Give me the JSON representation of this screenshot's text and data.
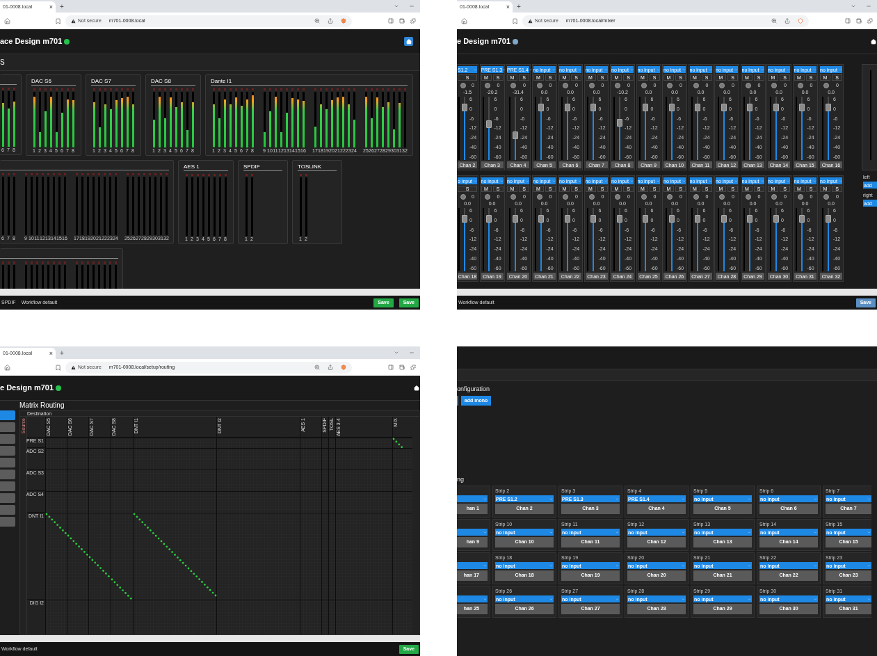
{
  "windows": [
    {
      "kind": "meters",
      "tab": {
        "title": "01-0008.local",
        "close": "×"
      },
      "new_tab": "+",
      "address": {
        "security": "Not secure",
        "url": "m701-0008.local"
      },
      "app_title": "ace Design m701",
      "status": {
        "color": "#27c24c"
      },
      "home": {
        "highlighted": true
      },
      "section": "S",
      "rows": [
        {
          "groups": [
            {
              "banks": [
                {
                  "meters": [
                    {
                      "label": "6",
                      "level": 0.82
                    },
                    {
                      "label": "7",
                      "level": 0.72
                    },
                    {
                      "label": "8",
                      "level": 0.85
                    }
                  ]
                }
              ]
            },
            {
              "title": "DAC S6",
              "banks": [
                {
                  "meters": [
                    {
                      "label": "1",
                      "level": 0.95
                    },
                    {
                      "label": "2",
                      "level": 0.28
                    },
                    {
                      "label": "3",
                      "level": 0.67
                    },
                    {
                      "label": "4",
                      "level": 0.95
                    },
                    {
                      "label": "5",
                      "level": 0.29
                    },
                    {
                      "label": "6",
                      "level": 0.65
                    },
                    {
                      "label": "7",
                      "level": 0.9
                    },
                    {
                      "label": "8",
                      "level": 0.88
                    }
                  ]
                }
              ]
            },
            {
              "title": "DAC S7",
              "banks": [
                {
                  "meters": [
                    {
                      "label": "1",
                      "level": 0.85
                    },
                    {
                      "label": "2",
                      "level": 0.38
                    },
                    {
                      "label": "3",
                      "level": 0.8
                    },
                    {
                      "label": "4",
                      "level": 0.72
                    },
                    {
                      "label": "5",
                      "level": 0.88
                    },
                    {
                      "label": "6",
                      "level": 0.92
                    },
                    {
                      "label": "7",
                      "level": 0.95
                    },
                    {
                      "label": "8",
                      "level": 0.8
                    }
                  ]
                }
              ]
            },
            {
              "title": "DAC S8",
              "banks": [
                {
                  "meters": [
                    {
                      "label": "1",
                      "level": 0.52
                    },
                    {
                      "label": "2",
                      "level": 0.95
                    },
                    {
                      "label": "3",
                      "level": 0.55
                    },
                    {
                      "label": "4",
                      "level": 0.93
                    },
                    {
                      "label": "5",
                      "level": 0.75
                    },
                    {
                      "label": "6",
                      "level": 0.85
                    },
                    {
                      "label": "7",
                      "level": 0.33
                    },
                    {
                      "label": "8",
                      "level": 0.85
                    }
                  ]
                }
              ]
            },
            {
              "title": "Dante I1",
              "banks": [
                {
                  "meters": [
                    {
                      "label": "1",
                      "level": 0.8
                    },
                    {
                      "label": "2",
                      "level": 0.54
                    },
                    {
                      "label": "3",
                      "level": 0.9
                    },
                    {
                      "label": "4",
                      "level": 0.8
                    },
                    {
                      "label": "5",
                      "level": 0.93
                    },
                    {
                      "label": "6",
                      "level": 0.78
                    },
                    {
                      "label": "7",
                      "level": 0.9
                    },
                    {
                      "label": "8",
                      "level": 0.98
                    }
                  ]
                },
                {
                  "meters": [
                    {
                      "label": "9",
                      "level": 0.28
                    },
                    {
                      "label": "10",
                      "level": 0.67
                    },
                    {
                      "label": "11",
                      "level": 0.95
                    },
                    {
                      "label": "12",
                      "level": 0.28
                    },
                    {
                      "label": "13",
                      "level": 0.65
                    },
                    {
                      "label": "14",
                      "level": 0.92
                    },
                    {
                      "label": "15",
                      "level": 0.9
                    },
                    {
                      "label": "16",
                      "level": 0.87
                    }
                  ]
                },
                {
                  "meters": [
                    {
                      "label": "17",
                      "level": 0.39
                    },
                    {
                      "label": "18",
                      "level": 0.8
                    },
                    {
                      "label": "19",
                      "level": 0.72
                    },
                    {
                      "label": "20",
                      "level": 0.88
                    },
                    {
                      "label": "21",
                      "level": 0.93
                    },
                    {
                      "label": "22",
                      "level": 0.95
                    },
                    {
                      "label": "23",
                      "level": 0.8
                    },
                    {
                      "label": "24",
                      "level": 0.52
                    }
                  ]
                },
                {
                  "meters": [
                    {
                      "label": "25",
                      "level": 0.95
                    },
                    {
                      "label": "26",
                      "level": 0.55
                    },
                    {
                      "label": "27",
                      "level": 0.93
                    },
                    {
                      "label": "28",
                      "level": 0.75
                    },
                    {
                      "label": "29",
                      "level": 0.85
                    },
                    {
                      "label": "30",
                      "level": 0.34
                    },
                    {
                      "label": "31",
                      "level": 0.83
                    },
                    {
                      "label": "32"
                    }
                  ]
                }
              ]
            }
          ]
        },
        {
          "groups": [
            {
              "banks": [
                {
                  "meters": [
                    {
                      "label": "6"
                    },
                    {
                      "label": "7"
                    },
                    {
                      "label": "8"
                    }
                  ]
                },
                {
                  "meters": [
                    {
                      "label": "9"
                    },
                    {
                      "label": "10"
                    },
                    {
                      "label": "11"
                    },
                    {
                      "label": "12"
                    },
                    {
                      "label": "13"
                    },
                    {
                      "label": "14"
                    },
                    {
                      "label": "15"
                    },
                    {
                      "label": "16"
                    }
                  ]
                },
                {
                  "meters": [
                    {
                      "label": "17"
                    },
                    {
                      "label": "18"
                    },
                    {
                      "label": "19"
                    },
                    {
                      "label": "20"
                    },
                    {
                      "label": "21"
                    },
                    {
                      "label": "22"
                    },
                    {
                      "label": "23"
                    },
                    {
                      "label": "24"
                    }
                  ]
                },
                {
                  "meters": [
                    {
                      "label": "25"
                    },
                    {
                      "label": "26"
                    },
                    {
                      "label": "27"
                    },
                    {
                      "label": "28"
                    },
                    {
                      "label": "29"
                    },
                    {
                      "label": "30"
                    },
                    {
                      "label": "31"
                    },
                    {
                      "label": "32"
                    }
                  ]
                }
              ]
            },
            {
              "title": "AES 1",
              "banks": [
                {
                  "meters": [
                    {
                      "label": "1"
                    },
                    {
                      "label": "2"
                    },
                    {
                      "label": "3"
                    },
                    {
                      "label": "4"
                    },
                    {
                      "label": "5"
                    },
                    {
                      "label": "6"
                    },
                    {
                      "label": "7"
                    },
                    {
                      "label": "8"
                    }
                  ]
                }
              ]
            },
            {
              "title": "SPDIF",
              "banks": [
                {
                  "meters": [
                    {
                      "label": "1"
                    },
                    {
                      "label": "2"
                    }
                  ]
                }
              ]
            },
            {
              "title": "TOSLINK",
              "banks": [
                {
                  "meters": [
                    {
                      "label": "1"
                    },
                    {
                      "label": "2"
                    }
                  ]
                }
              ]
            }
          ]
        },
        {
          "groups": [
            {
              "banks": [
                {
                  "meters": [
                    {
                      "clip": false
                    },
                    {
                      "clip": false
                    },
                    {
                      "clip": false
                    }
                  ]
                },
                {
                  "meters": [
                    {
                      "clip": false
                    },
                    {
                      "clip": false
                    },
                    {
                      "clip": false
                    },
                    {
                      "clip": false
                    },
                    {
                      "clip": false
                    },
                    {
                      "clip": false
                    },
                    {
                      "clip": false
                    },
                    {
                      "clip": false
                    }
                  ]
                },
                {
                  "meters": [
                    {
                      "clip": false
                    },
                    {
                      "clip": false
                    },
                    {
                      "clip": false
                    },
                    {
                      "clip": false
                    },
                    {
                      "clip": false
                    },
                    {
                      "clip": false
                    },
                    {
                      "clip": false
                    },
                    {
                      "clip": false
                    }
                  ]
                }
              ]
            }
          ]
        }
      ],
      "status_bar": {
        "items": [
          "SPDIF",
          "Workflow default"
        ],
        "buttons": [
          {
            "label": "Save",
            "kind": "success"
          },
          {
            "label": "Save",
            "kind": "success"
          }
        ]
      }
    },
    {
      "kind": "mixer",
      "tab": {
        "title": "01-0008.local",
        "close": "×"
      },
      "new_tab": "+",
      "address": {
        "security": "Not secure",
        "url": "m701-0008.local/mixer"
      },
      "app_title": "e Design m701",
      "status": {
        "color": "#7fa7c9"
      },
      "home": {
        "highlighted": false
      },
      "strip_rows": [
        {
          "strips": [
            {
              "input": "S1.2",
              "solo": "S",
              "pan": "0",
              "gain": "-1.5",
              "level": 0.88,
              "name": "Chan 2",
              "scale": [
                "6",
                "0",
                "-6",
                "-12",
                "-24",
                "-40",
                "-60"
              ]
            },
            {
              "input": "PRE S1.3",
              "mute": "M",
              "solo": "S",
              "pan": "0",
              "gain": "-20.2",
              "level": 0.58,
              "name": "Chan 3",
              "scale": [
                "6",
                "0",
                "-6",
                "-12",
                "-24",
                "-40",
                "-60"
              ]
            },
            {
              "input": "PRE S1.4",
              "mute": "M",
              "solo": "S",
              "pan": "0",
              "gain": "-31.4",
              "level": 0.38,
              "name": "Chan 4",
              "scale": [
                "6",
                "0",
                "-6",
                "-12",
                "-24",
                "-40",
                "-60"
              ]
            },
            {
              "input": "no input",
              "mute": "M",
              "solo": "S",
              "pan": "0",
              "gain": "0.0",
              "level": 0.88,
              "name": "Chan 5",
              "scale": [
                "6",
                "0",
                "-6",
                "-12",
                "-24",
                "-40",
                "-60"
              ]
            },
            {
              "input": "no input",
              "mute": "M",
              "solo": "S",
              "pan": "0",
              "gain": "0.0",
              "level": 0.88,
              "name": "Chan 6",
              "scale": [
                "6",
                "0",
                "-6",
                "-12",
                "-24",
                "-40",
                "-60"
              ]
            },
            {
              "input": "no input",
              "mute": "M",
              "solo": "S",
              "pan": "0",
              "gain": "0.0",
              "level": 0.88,
              "name": "Chan 7",
              "scale": [
                "6",
                "0",
                "-6",
                "-12",
                "-24",
                "-40",
                "-60"
              ]
            },
            {
              "input": "no input",
              "mute": "M",
              "solo": "S",
              "pan": "0",
              "gain": "-10.2",
              "level": 0.6,
              "name": "Chan 8",
              "scale": [
                "6",
                "0",
                "-6",
                "-12",
                "-24",
                "-40",
                "-60"
              ]
            },
            {
              "input": "no input",
              "mute": "M",
              "solo": "S",
              "pan": "0",
              "gain": "0.0",
              "level": 0.88,
              "name": "Chan 9",
              "scale": [
                "6",
                "0",
                "-6",
                "-12",
                "-24",
                "-40",
                "-60"
              ]
            },
            {
              "input": "no input",
              "mute": "M",
              "solo": "S",
              "pan": "0",
              "gain": "0.0",
              "level": 0.88,
              "name": "Chan 10",
              "scale": [
                "6",
                "0",
                "-6",
                "-12",
                "-24",
                "-40",
                "-60"
              ]
            },
            {
              "input": "no input",
              "mute": "M",
              "solo": "S",
              "pan": "0",
              "gain": "0.0",
              "level": 0.88,
              "name": "Chan 11",
              "scale": [
                "6",
                "0",
                "-6",
                "-12",
                "-24",
                "-40",
                "-60"
              ]
            },
            {
              "input": "no input",
              "mute": "M",
              "solo": "S",
              "pan": "0",
              "gain": "0.0",
              "level": 0.88,
              "name": "Chan 12",
              "scale": [
                "6",
                "0",
                "-6",
                "-12",
                "-24",
                "-40",
                "-60"
              ]
            },
            {
              "input": "no input",
              "mute": "M",
              "solo": "S",
              "pan": "0",
              "gain": "0.0",
              "level": 0.88,
              "name": "Chan 13",
              "scale": [
                "6",
                "0",
                "-6",
                "-12",
                "-24",
                "-40",
                "-60"
              ]
            },
            {
              "input": "no input",
              "mute": "M",
              "solo": "S",
              "pan": "0",
              "gain": "0.0",
              "level": 0.88,
              "name": "Chan 14",
              "scale": [
                "6",
                "0",
                "-6",
                "-12",
                "-24",
                "-40",
                "-60"
              ]
            },
            {
              "input": "no input",
              "mute": "M",
              "solo": "S",
              "pan": "0",
              "gain": "0.0",
              "level": 0.88,
              "name": "Chan 15",
              "scale": [
                "6",
                "0",
                "-6",
                "-12",
                "-24",
                "-40",
                "-60"
              ]
            },
            {
              "input": "no input",
              "mute": "M",
              "solo": "S",
              "pan": "0",
              "gain": "0.0",
              "level": 0.88,
              "name": "Chan 16",
              "scale": [
                "6",
                "0",
                "-6",
                "-12",
                "-24",
                "-40",
                "-60"
              ]
            }
          ]
        },
        {
          "strips": [
            {
              "input": "o input",
              "solo": "S",
              "pan": "0",
              "gain": "0.0",
              "level": 0.88,
              "name": "Chan 18",
              "scale": [
                "6",
                "0",
                "-6",
                "-12",
                "-24",
                "-40",
                "-60"
              ]
            },
            {
              "input": "no input",
              "mute": "M",
              "solo": "S",
              "pan": "0",
              "gain": "0.0",
              "level": 0.88,
              "name": "Chan 19",
              "scale": [
                "6",
                "0",
                "-6",
                "-12",
                "-24",
                "-40",
                "-60"
              ]
            },
            {
              "input": "no input",
              "mute": "M",
              "solo": "S",
              "pan": "0",
              "gain": "0.0",
              "level": 0.88,
              "name": "Chan 20",
              "scale": [
                "6",
                "0",
                "-6",
                "-12",
                "-24",
                "-40",
                "-60"
              ]
            },
            {
              "input": "no input",
              "mute": "M",
              "solo": "S",
              "pan": "0",
              "gain": "0.0",
              "level": 0.88,
              "name": "Chan 21",
              "scale": [
                "6",
                "0",
                "-6",
                "-12",
                "-24",
                "-40",
                "-60"
              ]
            },
            {
              "input": "no input",
              "mute": "M",
              "solo": "S",
              "pan": "0",
              "gain": "0.0",
              "level": 0.88,
              "name": "Chan 22",
              "scale": [
                "6",
                "0",
                "-6",
                "-12",
                "-24",
                "-40",
                "-60"
              ]
            },
            {
              "input": "no input",
              "mute": "M",
              "solo": "S",
              "pan": "0",
              "gain": "0.0",
              "level": 0.88,
              "name": "Chan 23",
              "scale": [
                "6",
                "0",
                "-6",
                "-12",
                "-24",
                "-40",
                "-60"
              ]
            },
            {
              "input": "no input",
              "mute": "M",
              "solo": "S",
              "pan": "0",
              "gain": "0.0",
              "level": 0.88,
              "name": "Chan 24",
              "scale": [
                "6",
                "0",
                "-6",
                "-12",
                "-24",
                "-40",
                "-60"
              ]
            },
            {
              "input": "no input",
              "mute": "M",
              "solo": "S",
              "pan": "0",
              "gain": "0.0",
              "level": 0.88,
              "name": "Chan 25",
              "scale": [
                "6",
                "0",
                "-6",
                "-12",
                "-24",
                "-40",
                "-60"
              ]
            },
            {
              "input": "no input",
              "mute": "M",
              "solo": "S",
              "pan": "0",
              "gain": "0.0",
              "level": 0.88,
              "name": "Chan 26",
              "scale": [
                "6",
                "0",
                "-6",
                "-12",
                "-24",
                "-40",
                "-60"
              ]
            },
            {
              "input": "no input",
              "mute": "M",
              "solo": "S",
              "pan": "0",
              "gain": "0.0",
              "level": 0.88,
              "name": "Chan 27",
              "scale": [
                "6",
                "0",
                "-6",
                "-12",
                "-24",
                "-40",
                "-60"
              ]
            },
            {
              "input": "no input",
              "mute": "M",
              "solo": "S",
              "pan": "0",
              "gain": "0.0",
              "level": 0.88,
              "name": "Chan 28",
              "scale": [
                "6",
                "0",
                "-6",
                "-12",
                "-24",
                "-40",
                "-60"
              ]
            },
            {
              "input": "no input",
              "mute": "M",
              "solo": "S",
              "pan": "0",
              "gain": "0.0",
              "level": 0.88,
              "name": "Chan 29",
              "scale": [
                "6",
                "0",
                "-6",
                "-12",
                "-24",
                "-40",
                "-60"
              ]
            },
            {
              "input": "no input",
              "mute": "M",
              "solo": "S",
              "pan": "0",
              "gain": "0.0",
              "level": 0.88,
              "name": "Chan 30",
              "scale": [
                "6",
                "0",
                "-6",
                "-12",
                "-24",
                "-40",
                "-60"
              ]
            },
            {
              "input": "no input",
              "mute": "M",
              "solo": "S",
              "pan": "0",
              "gain": "0.0",
              "level": 0.88,
              "name": "Chan 31",
              "scale": [
                "6",
                "0",
                "-6",
                "-12",
                "-24",
                "-40",
                "-60"
              ]
            },
            {
              "input": "no input",
              "mute": "M",
              "solo": "S",
              "pan": "0",
              "gain": "0.0",
              "level": 0.88,
              "name": "Chan 32",
              "scale": [
                "6",
                "0",
                "-6",
                "-12",
                "-24",
                "-40",
                "-60"
              ]
            }
          ]
        }
      ],
      "side_panel": [
        {
          "label": "left",
          "button": "add"
        },
        {
          "label": "right",
          "button": "add"
        }
      ],
      "status_bar": {
        "items": [
          "Workflow default"
        ],
        "buttons": [
          {
            "label": "Save",
            "kind": "primary"
          }
        ]
      }
    },
    {
      "kind": "routing",
      "tab": {
        "title": "01-0008.local",
        "close": "×"
      },
      "new_tab": "+",
      "address": {
        "security": "Not secure",
        "url": "m701-0008.local/setup/routing"
      },
      "app_title": "e Design m701",
      "status": {
        "color": "#27c24c"
      },
      "home": {
        "highlighted": false
      },
      "title": "Matrix Routing",
      "sidebar": [
        {
          "selected": true
        },
        {
          "selected": false
        },
        {
          "selected": false
        },
        {
          "selected": false
        },
        {
          "selected": false
        },
        {
          "selected": false
        },
        {
          "selected": false
        },
        {
          "selected": false
        },
        {
          "selected": false
        },
        {
          "selected": false
        }
      ],
      "destination_label": "Destination",
      "source_label": "Source",
      "columns": [
        {
          "label": "DAC S5"
        },
        {
          "label": "DAC S6"
        },
        {
          "label": "DAC S7"
        },
        {
          "label": "DAC S8"
        },
        {
          "label": "DNT I1"
        },
        {
          "label": "DNT I2"
        },
        {
          "label": "AES 1"
        },
        {
          "label": "SPDIF"
        },
        {
          "label": "TOSL"
        },
        {
          "label": "AES 3-4"
        },
        {
          "label": "MIX"
        }
      ],
      "rows": [
        {
          "label": "PRE S1",
          "routes": [
            false,
            false,
            false,
            false,
            false,
            false,
            false,
            false,
            false,
            false,
            true
          ]
        },
        {
          "label": "ADC S2",
          "routes": [
            false,
            false,
            false,
            false,
            false,
            false,
            false,
            false,
            false,
            false,
            false
          ]
        },
        {
          "label": "ADC S3",
          "routes": [
            false,
            false,
            false,
            false,
            false,
            false,
            false,
            false,
            false,
            false,
            false
          ]
        },
        {
          "label": "ADC S4",
          "routes": [
            false,
            false,
            false,
            false,
            false,
            false,
            false,
            false,
            false,
            false,
            false
          ]
        },
        {
          "label": "DNT I1",
          "routes": [
            true,
            true,
            true,
            true,
            true,
            false,
            false,
            false,
            false,
            false,
            false
          ]
        },
        {
          "label": "DIG I2",
          "routes": [
            false,
            false,
            false,
            false,
            false,
            false,
            false,
            false,
            false,
            false,
            false
          ]
        }
      ],
      "status_bar": {
        "items": [
          "Workflow default"
        ],
        "buttons": [
          {
            "label": "Save",
            "kind": "success"
          }
        ]
      }
    },
    {
      "kind": "strips",
      "heading": "onfiguration",
      "add_button": "add mono",
      "strips_heading": "ng",
      "card_rows": [
        {
          "cards": [
            {
              "channel": "han 1"
            },
            {
              "strip": "Strip 2",
              "input": "PRE S1.2",
              "channel": "Chan 2"
            },
            {
              "strip": "Strip 3",
              "input": "PRE S1.3",
              "channel": "Chan 3"
            },
            {
              "strip": "Strip 4",
              "input": "PRE S1.4",
              "channel": "Chan 4"
            },
            {
              "strip": "Strip 5",
              "input": "no input",
              "channel": "Chan 5"
            },
            {
              "strip": "Strip 6",
              "input": "no input",
              "channel": "Chan 6"
            },
            {
              "strip": "Strip 7",
              "input": "no input",
              "channel": "Chan 7"
            }
          ]
        },
        {
          "cards": [
            {
              "channel": "han 9"
            },
            {
              "strip": "Strip 10",
              "input": "no input",
              "channel": "Chan 10"
            },
            {
              "strip": "Strip 11",
              "input": "no input",
              "channel": "Chan 11"
            },
            {
              "strip": "Strip 12",
              "input": "no input",
              "channel": "Chan 12"
            },
            {
              "strip": "Strip 13",
              "input": "no input",
              "channel": "Chan 13"
            },
            {
              "strip": "Strip 14",
              "input": "no input",
              "channel": "Chan 14"
            },
            {
              "strip": "Strip 15",
              "input": "no input",
              "channel": "Chan 15"
            }
          ]
        },
        {
          "cards": [
            {
              "channel": "han 17"
            },
            {
              "strip": "Strip 18",
              "input": "no input",
              "channel": "Chan 18"
            },
            {
              "strip": "Strip 19",
              "input": "no input",
              "channel": "Chan 19"
            },
            {
              "strip": "Strip 20",
              "input": "no input",
              "channel": "Chan 20"
            },
            {
              "strip": "Strip 21",
              "input": "no input",
              "channel": "Chan 21"
            },
            {
              "strip": "Strip 22",
              "input": "no input",
              "channel": "Chan 22"
            },
            {
              "strip": "Strip 23",
              "input": "no input",
              "channel": "Chan 23"
            }
          ]
        },
        {
          "cards": [
            {
              "channel": "han 25"
            },
            {
              "strip": "Strip 26",
              "input": "no input",
              "channel": "Chan 26"
            },
            {
              "strip": "Strip 27",
              "input": "no input",
              "channel": "Chan 27"
            },
            {
              "strip": "Strip 28",
              "input": "no input",
              "channel": "Chan 28"
            },
            {
              "strip": "Strip 29",
              "input": "no input",
              "channel": "Chan 29"
            },
            {
              "strip": "Strip 30",
              "input": "no input",
              "channel": "Chan 30"
            },
            {
              "strip": "Strip 31",
              "input": "no input",
              "channel": "Chan 31"
            }
          ]
        }
      ]
    }
  ]
}
